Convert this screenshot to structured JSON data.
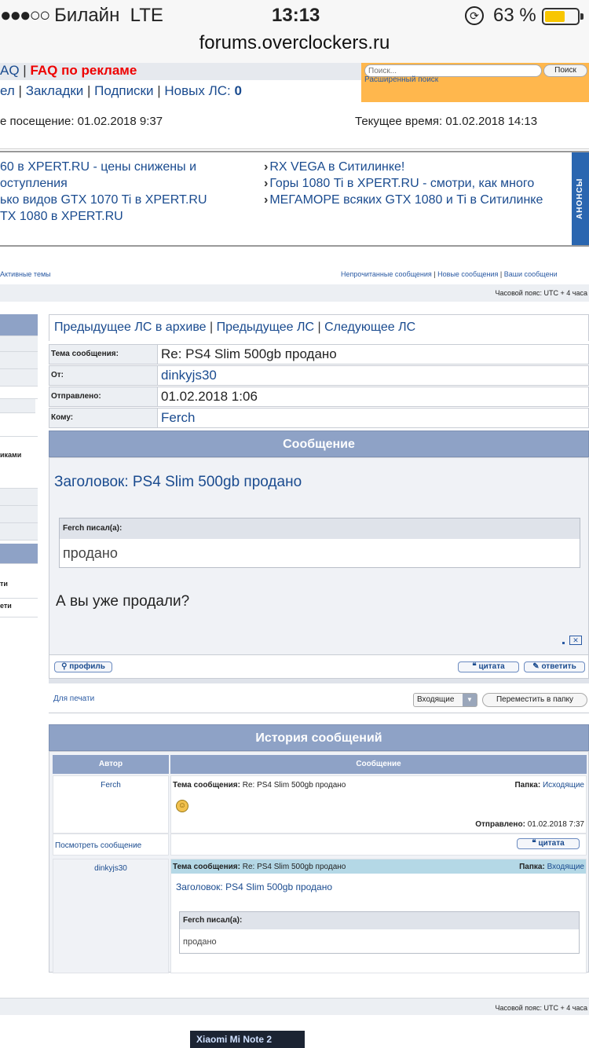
{
  "status": {
    "signal": "●●●○○",
    "carrier": "Билайн",
    "network": "LTE",
    "time": "13:13",
    "battery_text": "63 %",
    "battery_level": 0.63,
    "url": "forums.overclockers.ru"
  },
  "topnav": {
    "faq": "AQ",
    "faq_ads": "FAQ по рекламе",
    "cut_item": "ел",
    "bookmarks": "Закладки",
    "subscriptions": "Подписки",
    "new_pm_label": "Новых ЛС:",
    "new_pm_count": "0"
  },
  "search": {
    "placeholder": "Поиск...",
    "button": "Поиск",
    "advanced": "Расширенный поиск"
  },
  "visits": {
    "last": "е посещение: 01.02.2018 9:37",
    "current": "Текущее время: 01.02.2018 14:13"
  },
  "ads": {
    "left": [
      "60 в XPERT.RU - цены снижены и",
      "оступления",
      "ько видов GTX 1070 Ti в XPERT.RU",
      "TX 1080 в XPERT.RU"
    ],
    "right": [
      {
        "text": "RX VEGA в Ситилинке!"
      },
      {
        "text": "Горы 1080 Ti в XPERT.RU - смотри, как много"
      },
      {
        "text": "МЕГАМОРЕ всяких GTX 1080 и Ti в Ситилинке"
      }
    ],
    "tab": "АНОНСЫ"
  },
  "subnav": {
    "active": "Активные темы",
    "unread": "Непрочитанные сообщения",
    "new_msgs": "Новые сообщения",
    "yours": "Ваши сообщени"
  },
  "timezone": "Часовой пояс: UTC + 4 часа",
  "sidebar": {
    "item_a": "иками",
    "item_b": "ти",
    "item_c": "ети"
  },
  "pm": {
    "nav_prev_archive": "Предыдущее ЛС в архиве",
    "nav_prev": "Предыдущее ЛС",
    "nav_next": "Следующее ЛС",
    "subject_label": "Тема сообщения:",
    "subject": "Re: PS4 Slim 500gb продано",
    "from_label": "От:",
    "from": "dinkyjs30",
    "sent_label": "Отправлено:",
    "sent": "01.02.2018 1:06",
    "to_label": "Кому:",
    "to": "Ferch",
    "message_header": "Сообщение",
    "title": "Заголовок: PS4 Slim 500gb продано",
    "quote_author": "Ferch писал(а):",
    "quote_text": "продано",
    "reply": "А вы уже продали?",
    "profile_btn": "профиль",
    "quote_btn": "цитата",
    "reply_btn": "ответить",
    "print": "Для печати",
    "folder": "Входящие",
    "move_btn": "Переместить в папку"
  },
  "history": {
    "header": "История сообщений",
    "col_author": "Автор",
    "col_message": "Сообщение",
    "rows": [
      {
        "author": "Ferch",
        "subject_label": "Тема сообщения:",
        "subject": "Re: PS4 Slim 500gb продано",
        "folder_label": "Папка:",
        "folder": "Исходящие",
        "sent_label": "Отправлено:",
        "sent": "01.02.2018 7:37",
        "view": "Посмотреть сообщение",
        "quote_btn": "цитата"
      },
      {
        "author": "dinkyjs30",
        "subject_label": "Тема сообщения:",
        "subject": "Re: PS4 Slim 500gb продано",
        "folder_label": "Папка:",
        "folder": "Входящие",
        "title": "Заголовок: PS4 Slim 500gb продано",
        "quote_author": "Ferch писал(а):",
        "quote_text": "продано"
      }
    ]
  },
  "banner": "Xiaomi Mi Note 2",
  "colors": {
    "link": "#1a4b8f",
    "accent_red": "#e00000",
    "header_blue": "#8ea2c6",
    "search_orange": "#ffb74d",
    "battery": "#f8c600"
  }
}
